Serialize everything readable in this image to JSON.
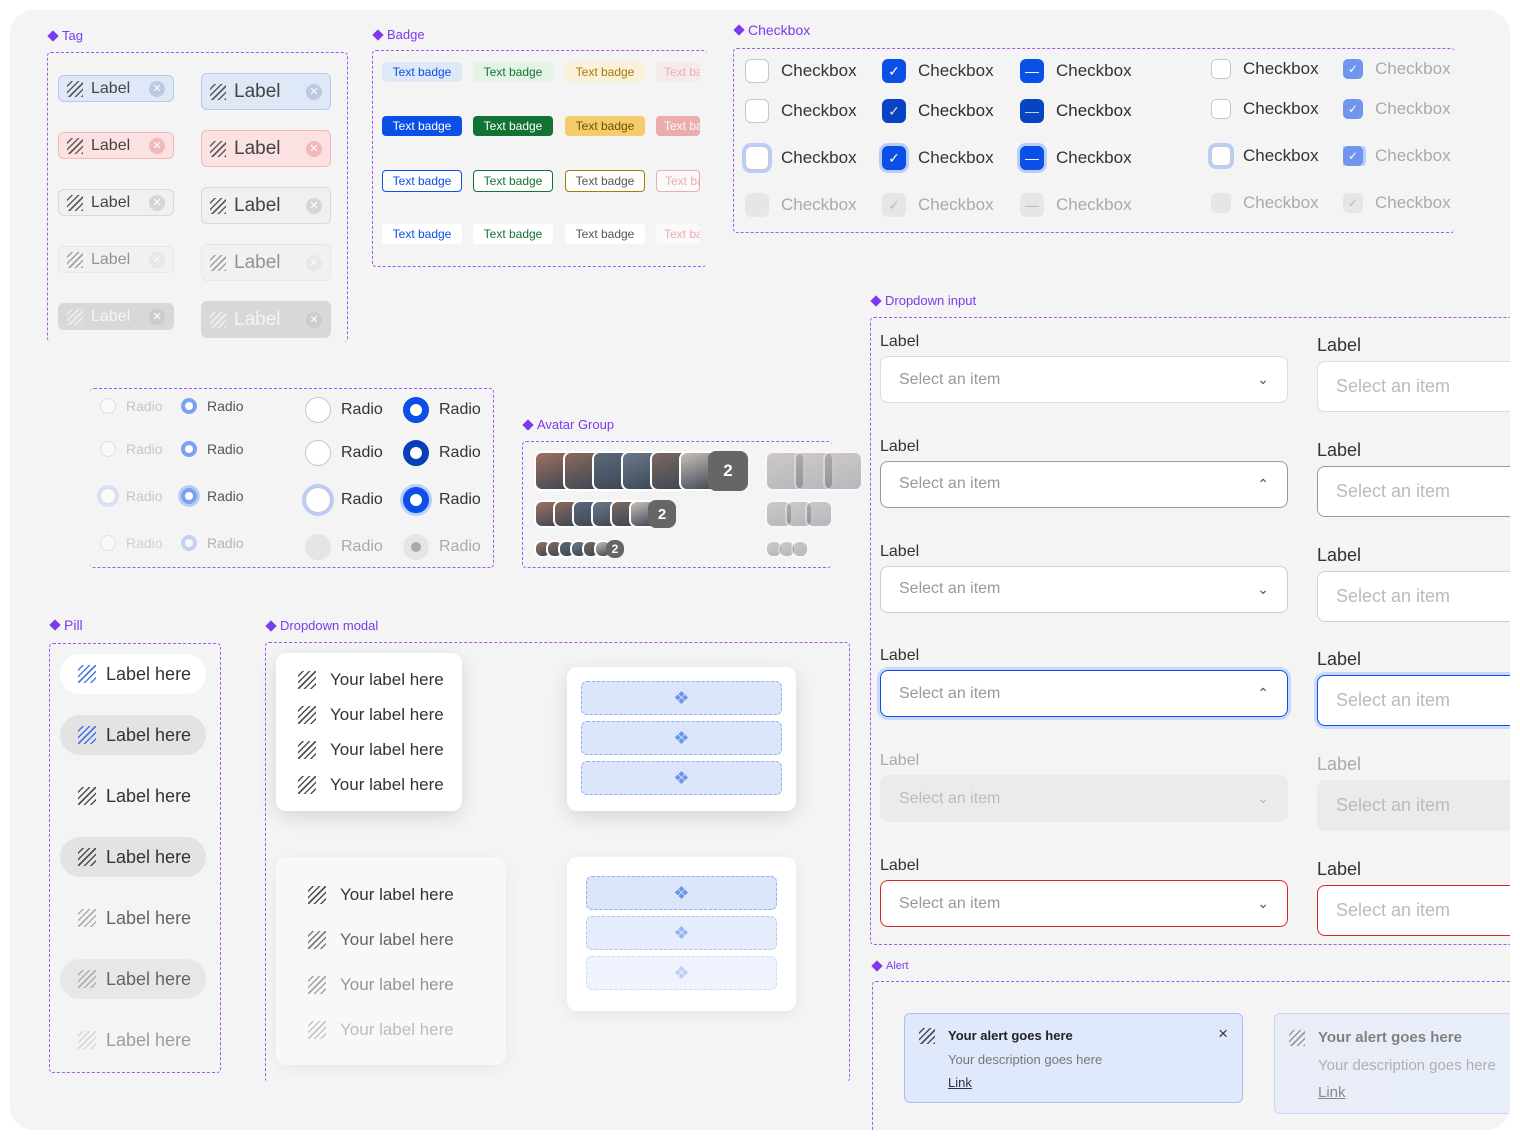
{
  "sections": {
    "tag": "Tag",
    "badge": "Badge",
    "checkbox": "Checkbox",
    "dropdown_input": "Dropdown input",
    "avatar_group": "Avatar Group",
    "pill": "Pill",
    "dropdown_modal": "Dropdown modal",
    "alert": "Alert"
  },
  "tag": {
    "label": "Label",
    "close_icon": "close-icon"
  },
  "badge": {
    "text": "Text badge",
    "truncated": "Text ba"
  },
  "checkbox": {
    "label": "Checkbox"
  },
  "radio": {
    "label": "Radio"
  },
  "avatar_group": {
    "count": "2"
  },
  "pill": {
    "label": "Label here"
  },
  "dropdown_modal": {
    "item": "Your label here"
  },
  "dropdown_input": {
    "label": "Label",
    "placeholder": "Select an item"
  },
  "alert": {
    "title": "Your alert goes here",
    "description": "Your description goes here",
    "link": "Link",
    "close": "×"
  },
  "colors": {
    "accent": "#7c3aed",
    "primary": "#0a4fe6",
    "error": "#dc2626"
  }
}
